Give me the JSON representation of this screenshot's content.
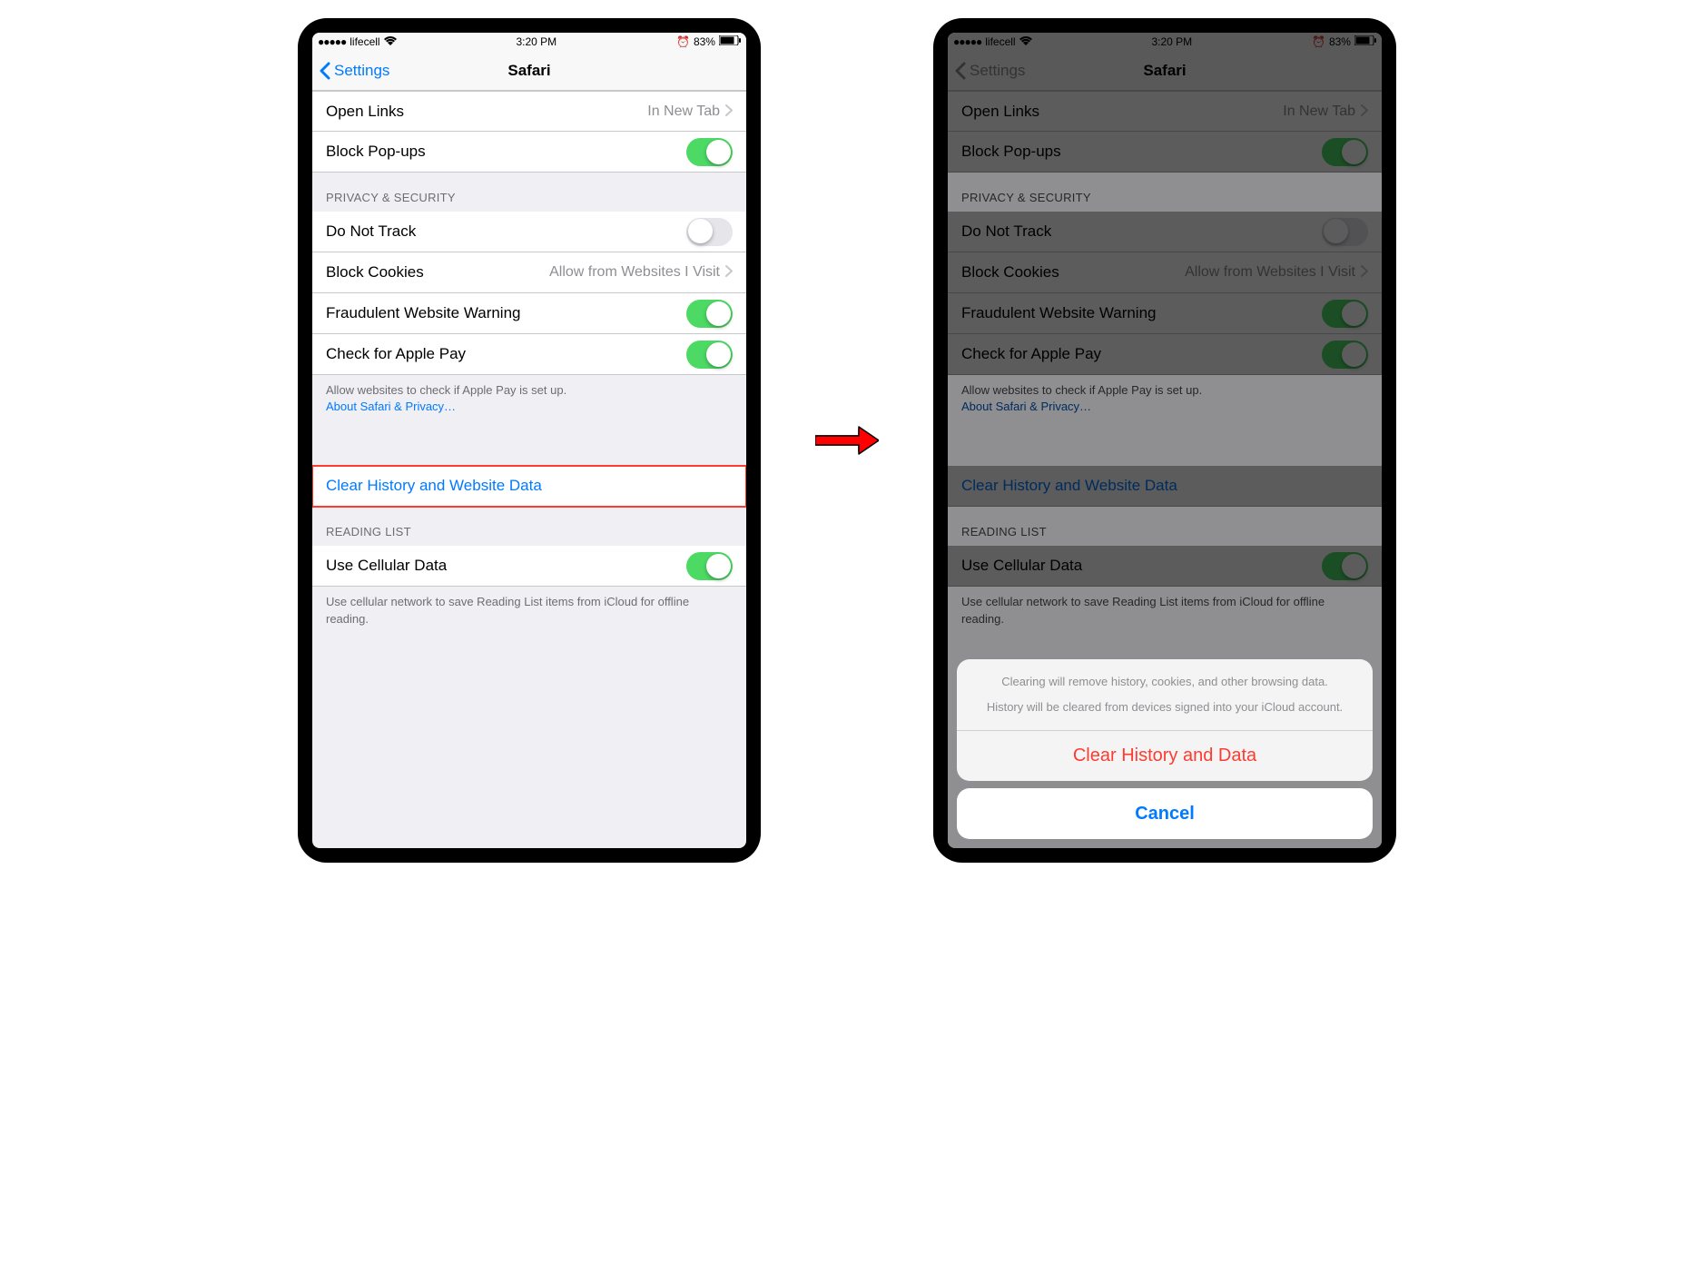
{
  "status": {
    "dots": "●●●●●",
    "carrier": "lifecell",
    "time": "3:20 PM",
    "battery": "83%"
  },
  "nav": {
    "back": "Settings",
    "title": "Safari"
  },
  "rows": {
    "openLinks": {
      "label": "Open Links",
      "value": "In New Tab"
    },
    "blockPopups": {
      "label": "Block Pop-ups"
    },
    "privacyHeader": "PRIVACY & SECURITY",
    "doNotTrack": {
      "label": "Do Not Track"
    },
    "blockCookies": {
      "label": "Block Cookies",
      "value": "Allow from Websites I Visit"
    },
    "fraudulent": {
      "label": "Fraudulent Website Warning"
    },
    "applePay": {
      "label": "Check for Apple Pay"
    },
    "applePayFooter": "Allow websites to check if Apple Pay is set up.",
    "aboutLink": "About Safari & Privacy…",
    "clearHistory": {
      "label": "Clear History and Website Data"
    },
    "readingHeader": "READING LIST",
    "cellular": {
      "label": "Use Cellular Data"
    },
    "cellularFooter": "Use cellular network to save Reading List items from iCloud for offline reading."
  },
  "sheet": {
    "message1": "Clearing will remove history, cookies, and other browsing data.",
    "message2": "History will be cleared from devices signed into your iCloud account.",
    "clear": "Clear History and Data",
    "cancel": "Cancel"
  }
}
